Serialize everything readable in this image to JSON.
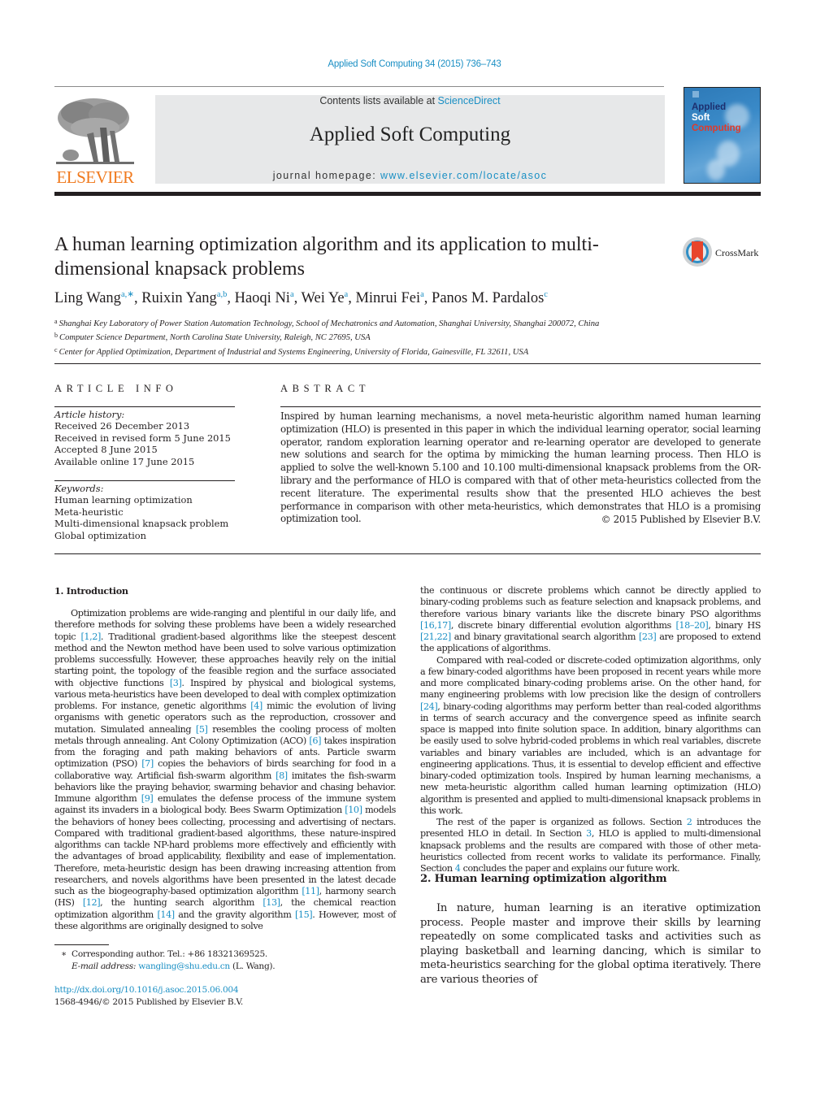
{
  "header": {
    "journal_reference": "Applied Soft Computing 34 (2015) 736–743",
    "contents_prefix": "Contents lists available at ",
    "contents_link": "ScienceDirect",
    "journal_title": "Applied Soft Computing",
    "homepage_prefix": "journal homepage: ",
    "homepage_link": "www.elsevier.com/locate/asoc",
    "publisher_logo_text": "ELSEVIER",
    "cover": {
      "line1": "Applied",
      "line2": "Soft",
      "line3": "Computing"
    },
    "colors": {
      "link": "#1a8fc4",
      "elsevier_orange": "#f07a1e",
      "cover_blue": "#3a8ac8",
      "cover_title_dark": "#1d2f6e",
      "cover_title_red": "#e03a2a"
    }
  },
  "article": {
    "title": "A human learning optimization algorithm and its application to multi-dimensional knapsack problems",
    "crossmark_label": "CrossMark",
    "authors": [
      {
        "name": "Ling Wang",
        "sup": "a,∗"
      },
      {
        "name": "Ruixin Yang",
        "sup": "a,b"
      },
      {
        "name": "Haoqi Ni",
        "sup": "a"
      },
      {
        "name": "Wei Ye",
        "sup": "a"
      },
      {
        "name": "Minrui Fei",
        "sup": "a"
      },
      {
        "name": "Panos M. Pardalos",
        "sup": "c"
      }
    ],
    "affiliations": [
      {
        "mark": "a",
        "text": "Shanghai Key Laboratory of Power Station Automation Technology, School of Mechatronics and Automation, Shanghai University, Shanghai 200072, China"
      },
      {
        "mark": "b",
        "text": "Computer Science Department, North Carolina State University, Raleigh, NC 27695, USA"
      },
      {
        "mark": "c",
        "text": "Center for Applied Optimization, Department of Industrial and Systems Engineering, University of Florida, Gainesville, FL 32611, USA"
      }
    ]
  },
  "article_info": {
    "heading": "ARTICLE INFO",
    "history_label": "Article history:",
    "history": [
      "Received 26 December 2013",
      "Received in revised form 5 June 2015",
      "Accepted 8 June 2015",
      "Available online 17 June 2015"
    ],
    "keywords_label": "Keywords:",
    "keywords": [
      "Human learning optimization",
      "Meta-heuristic",
      "Multi-dimensional knapsack problem",
      "Global optimization"
    ]
  },
  "abstract": {
    "heading": "ABSTRACT",
    "text": "Inspired by human learning mechanisms, a novel meta-heuristic algorithm named human learning optimization (HLO) is presented in this paper in which the individual learning operator, social learning operator, random exploration learning operator and re-learning operator are developed to generate new solutions and search for the optima by mimicking the human learning process. Then HLO is applied to solve the well-known 5.100 and 10.100 multi-dimensional knapsack problems from the OR-library and the performance of HLO is compared with that of other meta-heuristics collected from the recent literature. The experimental results show that the presented HLO achieves the best performance in comparison with other meta-heuristics, which demonstrates that HLO is a promising optimization tool.",
    "copyright": "© 2015 Published by Elsevier B.V."
  },
  "section1": {
    "heading": "1.  Introduction",
    "left_paragraph": [
      {
        "t": "Optimization problems are wide-ranging and plentiful in our daily life, and therefore methods for solving these problems have been a widely researched topic "
      },
      {
        "c": "[1,2]"
      },
      {
        "t": ". Traditional gradient-based algorithms like the steepest descent method and the Newton method have been used to solve various optimization problems successfully. However, these approaches heavily rely on the initial starting point, the topology of the feasible region and the surface associated with objective functions "
      },
      {
        "c": "[3]"
      },
      {
        "t": ". Inspired by physical and biological systems, various meta-heuristics have been developed to deal with complex optimization problems. For instance, genetic algorithms "
      },
      {
        "c": "[4]"
      },
      {
        "t": " mimic the evolution of living organisms with genetic operators such as the reproduction, crossover and mutation. Simulated annealing "
      },
      {
        "c": "[5]"
      },
      {
        "t": " resembles the cooling process of molten metals through annealing. Ant Colony Optimization (ACO) "
      },
      {
        "c": "[6]"
      },
      {
        "t": " takes inspiration from the foraging and path making behaviors of ants. Particle swarm optimization (PSO) "
      },
      {
        "c": "[7]"
      },
      {
        "t": " copies the behaviors of birds searching for food in a collaborative way. Artificial fish-swarm algorithm "
      },
      {
        "c": "[8]"
      },
      {
        "t": " imitates the fish-swarm behaviors like the praying behavior, swarming behavior and chasing behavior. Immune algorithm "
      },
      {
        "c": "[9]"
      },
      {
        "t": " emulates the defense process of the immune system against its invaders in a biological body. Bees Swarm Optimization "
      },
      {
        "c": "[10]"
      },
      {
        "t": " models the behaviors of honey bees collecting, processing and advertising of nectars. Compared with traditional gradient-based algorithms, these nature-inspired algorithms can tackle NP-hard problems more effectively and efficiently with the advantages of broad applicability, flexibility and ease of implementation. Therefore, meta-heuristic design has been drawing increasing attention from researchers, and novels algorithms have been presented in the latest decade such as the biogeography-based optimization algorithm "
      },
      {
        "c": "[11]"
      },
      {
        "t": ", harmony search (HS) "
      },
      {
        "c": "[12]"
      },
      {
        "t": ", the hunting search algorithm "
      },
      {
        "c": "[13]"
      },
      {
        "t": ", the chemical reaction optimization algorithm "
      },
      {
        "c": "[14]"
      },
      {
        "t": " and the gravity algorithm "
      },
      {
        "c": "[15]"
      },
      {
        "t": ". However, most of these algorithms are originally designed to solve"
      }
    ],
    "right_paragraph_1": [
      {
        "t": "the continuous or discrete problems which cannot be directly applied to binary-coding problems such as feature selection and knapsack problems, and therefore various binary variants like the discrete binary PSO algorithms "
      },
      {
        "c": "[16,17]"
      },
      {
        "t": ", discrete binary differential evolution algorithms "
      },
      {
        "c": "[18–20]"
      },
      {
        "t": ", binary HS "
      },
      {
        "c": "[21,22]"
      },
      {
        "t": " and binary gravitational search algorithm "
      },
      {
        "c": "[23]"
      },
      {
        "t": " are proposed to extend the applications of algorithms."
      }
    ],
    "right_paragraph_2": [
      {
        "t": "Compared with real-coded or discrete-coded optimization algorithms, only a few binary-coded algorithms have been proposed in recent years while more and more complicated binary-coding problems arise. On the other hand, for many engineering problems with low precision like the design of controllers "
      },
      {
        "c": "[24]"
      },
      {
        "t": ", binary-coding algorithms may perform better than real-coded algorithms in terms of search accuracy and the convergence speed as infinite search space is mapped into finite solution space. In addition, binary algorithms can be easily used to solve hybrid-coded problems in which real variables, discrete variables and binary variables are included, which is an advantage for engineering applications. Thus, it is essential to develop efficient and effective binary-coded optimization tools. Inspired by human learning mechanisms, a new meta-heuristic algorithm called human learning optimization (HLO) algorithm is presented and applied to multi-dimensional knapsack problems in this work."
      }
    ],
    "right_paragraph_3": [
      {
        "t": "The rest of the paper is organized as follows. Section "
      },
      {
        "c": "2"
      },
      {
        "t": " introduces the presented HLO in detail. In Section "
      },
      {
        "c": "3"
      },
      {
        "t": ", HLO is applied to multi-dimensional knapsack problems and the results are compared with those of other meta-heuristics collected from recent works to validate its performance. Finally, Section "
      },
      {
        "c": "4"
      },
      {
        "t": " concludes the paper and explains our future work."
      }
    ]
  },
  "section2": {
    "heading": "2.  Human learning optimization algorithm",
    "paragraph": "In nature, human learning is an iterative optimization process. People master and improve their skills by learning repeatedly on some complicated tasks and activities such as playing basketball and learning dancing, which is similar to meta-heuristics searching for the global optima iteratively. There are various theories of"
  },
  "footnote": {
    "mark": "∗",
    "corresponding": "Corresponding author. Tel.: +86 18321369525.",
    "email_label": "E-mail address: ",
    "email": "wangling@shu.edu.cn",
    "email_suffix": " (L. Wang).",
    "doi": "http://dx.doi.org/10.1016/j.asoc.2015.06.004",
    "issn_line": "1568-4946/© 2015 Published by Elsevier B.V."
  }
}
